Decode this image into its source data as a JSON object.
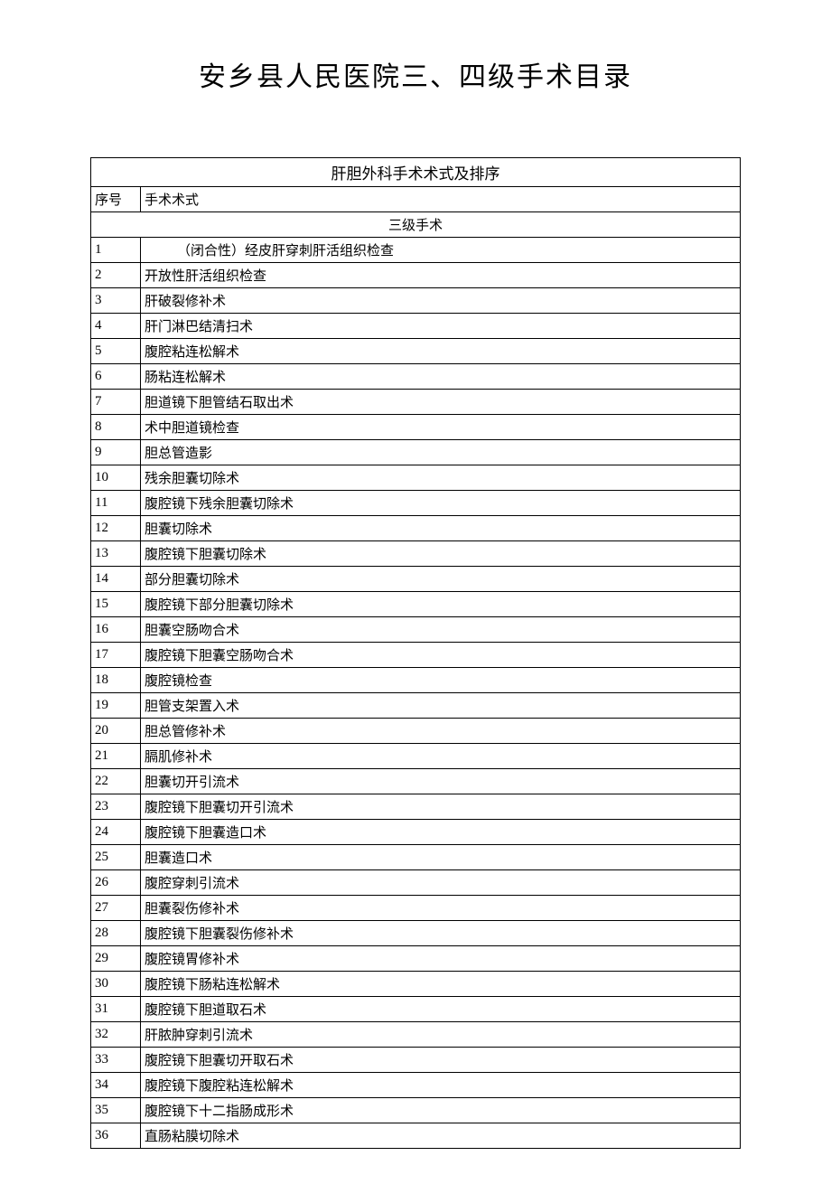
{
  "title": "安乡县人民医院三、四级手术目录",
  "table_header": "肝胆外科手术术式及排序",
  "col_seq": "序号",
  "col_proc": "手术术式",
  "section": "三级手术",
  "rows": [
    {
      "seq": "1",
      "proc": "（闭合性）经皮肝穿刺肝活组织检查",
      "indent": true
    },
    {
      "seq": "2",
      "proc": "开放性肝活组织检查"
    },
    {
      "seq": "3",
      "proc": "肝破裂修补术"
    },
    {
      "seq": "4",
      "proc": "肝门淋巴结清扫术"
    },
    {
      "seq": "5",
      "proc": "腹腔粘连松解术"
    },
    {
      "seq": "6",
      "proc": "肠粘连松解术"
    },
    {
      "seq": "7",
      "proc": "胆道镜下胆管结石取出术"
    },
    {
      "seq": "8",
      "proc": "术中胆道镜检查"
    },
    {
      "seq": "9",
      "proc": "胆总管造影"
    },
    {
      "seq": "10",
      "proc": "残余胆囊切除术"
    },
    {
      "seq": "11",
      "proc": "腹腔镜下残余胆囊切除术"
    },
    {
      "seq": "12",
      "proc": "胆囊切除术"
    },
    {
      "seq": "13",
      "proc": "腹腔镜下胆囊切除术"
    },
    {
      "seq": "14",
      "proc": "部分胆囊切除术"
    },
    {
      "seq": "15",
      "proc": "腹腔镜下部分胆囊切除术"
    },
    {
      "seq": "16",
      "proc": "胆囊空肠吻合术"
    },
    {
      "seq": "17",
      "proc": "腹腔镜下胆囊空肠吻合术"
    },
    {
      "seq": "18",
      "proc": "腹腔镜检查"
    },
    {
      "seq": "19",
      "proc": "胆管支架置入术"
    },
    {
      "seq": "20",
      "proc": "胆总管修补术"
    },
    {
      "seq": "21",
      "proc": "膈肌修补术"
    },
    {
      "seq": "22",
      "proc": "胆囊切开引流术"
    },
    {
      "seq": "23",
      "proc": "腹腔镜下胆囊切开引流术"
    },
    {
      "seq": "24",
      "proc": "腹腔镜下胆囊造口术"
    },
    {
      "seq": "25",
      "proc": "胆囊造口术"
    },
    {
      "seq": "26",
      "proc": "腹腔穿刺引流术"
    },
    {
      "seq": "27",
      "proc": "胆囊裂伤修补术"
    },
    {
      "seq": "28",
      "proc": "腹腔镜下胆囊裂伤修补术"
    },
    {
      "seq": "29",
      "proc": "腹腔镜胃修补术"
    },
    {
      "seq": "30",
      "proc": "腹腔镜下肠粘连松解术"
    },
    {
      "seq": "31",
      "proc": "腹腔镜下胆道取石术"
    },
    {
      "seq": "32",
      "proc": "肝脓肿穿刺引流术"
    },
    {
      "seq": "33",
      "proc": "腹腔镜下胆囊切开取石术"
    },
    {
      "seq": "34",
      "proc": "腹腔镜下腹腔粘连松解术"
    },
    {
      "seq": "35",
      "proc": "腹腔镜下十二指肠成形术"
    },
    {
      "seq": "36",
      "proc": "直肠粘膜切除术"
    }
  ]
}
